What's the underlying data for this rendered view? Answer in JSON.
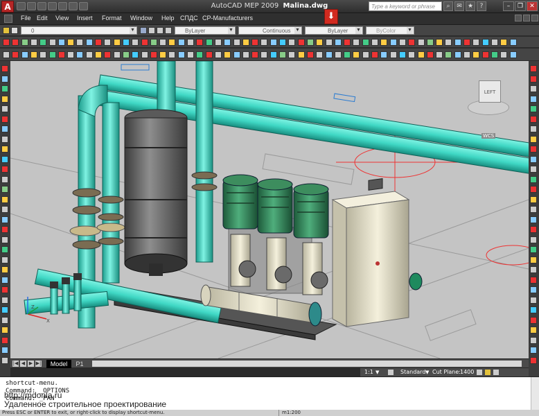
{
  "app": {
    "title": "AutoCAD MEP 2009",
    "filename": "Malina.dwg",
    "logo_letter": "A",
    "search_placeholder": "Type a keyword or phrase"
  },
  "menus": [
    "File",
    "Edit",
    "View",
    "Insert",
    "Format",
    "Window",
    "Help",
    "СПДС",
    "CP-Manufacturers"
  ],
  "props_toolbar": {
    "layer_value": "0",
    "color": "ByLayer",
    "linetype": "Continuous",
    "lineweight": "ByLayer",
    "plotstyle": "ByColor"
  },
  "viewcube": {
    "face": "LEFT",
    "ucs": "WCS"
  },
  "layout_tabs": [
    "Model",
    "P1"
  ],
  "status": {
    "scale": "1:1",
    "style": "Standard",
    "cut_plane_label": "Cut Plane:",
    "cut_plane_value": "1400",
    "hint": "Press ESC or ENTER to exit, or right-click to display shortcut-menu.",
    "drawing_scale": "m1:200"
  },
  "command_lines": [
    "shortcut-menu.",
    "Command: _OPTIONS",
    "Command: _PAN"
  ],
  "watermark": {
    "url": "http://mdonla.ru",
    "caption": "Удаленное строительное проектирование"
  },
  "colors": {
    "pipe": "#3fd7c4",
    "pump": "#2e7d52",
    "tank": "#6b6b6b",
    "frame": "#4a4a4a",
    "cabinet": "#e8e4cf",
    "accent": "#d22a1f"
  }
}
